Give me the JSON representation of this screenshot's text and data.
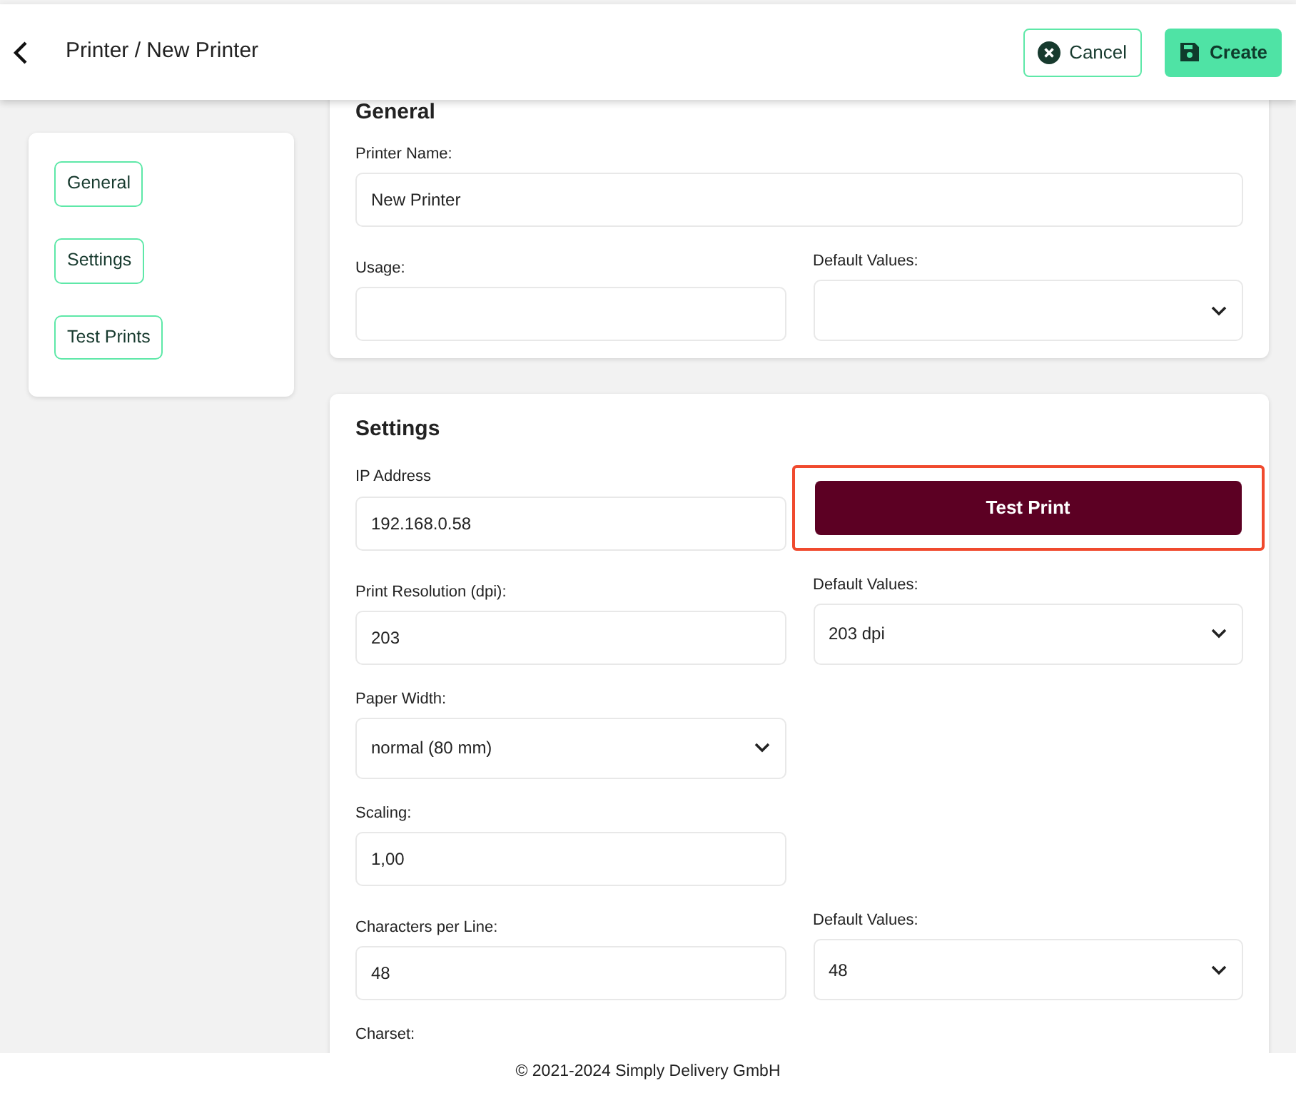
{
  "header": {
    "breadcrumb": "Printer / New Printer",
    "buttons": [
      {
        "label": "Cancel",
        "kind": "outline"
      },
      {
        "label": "Create",
        "kind": "primary"
      }
    ]
  },
  "sidebar": {
    "items": [
      {
        "label": "General"
      },
      {
        "label": "Settings"
      },
      {
        "label": "Test Prints"
      }
    ]
  },
  "sections": [
    {
      "title": "General",
      "rows": [
        [
          {
            "kind": "input",
            "label": "Printer Name:",
            "value": "New Printer",
            "wide": true
          }
        ],
        [
          {
            "kind": "input",
            "label": "Usage:"
          },
          {
            "kind": "select",
            "label": "Default Values:"
          }
        ]
      ]
    },
    {
      "title": "Settings",
      "rows": [
        [
          {
            "kind": "input",
            "label": "IP Address",
            "value": "192.168.0.58"
          },
          {
            "kind": "button",
            "label": "Test Print",
            "highlighted": true
          }
        ],
        [
          {
            "kind": "input",
            "label": "Print Resolution (dpi):",
            "value": "203"
          },
          {
            "kind": "select",
            "label": "Default Values:",
            "value": "203 dpi"
          }
        ],
        [
          {
            "kind": "select",
            "label": "Paper Width:",
            "value": "normal (80 mm)"
          }
        ],
        [
          {
            "kind": "input",
            "label": "Scaling:",
            "value": "1,00"
          }
        ],
        [
          {
            "kind": "input",
            "label": "Characters per Line:",
            "value": "48"
          },
          {
            "kind": "select",
            "label": "Default Values:",
            "value": "48"
          }
        ],
        [
          {
            "kind": "label",
            "label": "Charset:"
          }
        ]
      ]
    }
  ],
  "footer": {
    "text": "© 2021-2024 Simply Delivery GmbH"
  }
}
